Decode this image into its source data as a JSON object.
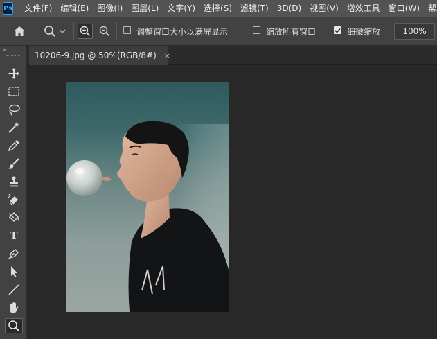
{
  "app": {
    "logo_text": "Ps"
  },
  "menu": {
    "items": [
      "文件(F)",
      "编辑(E)",
      "图像(I)",
      "图层(L)",
      "文字(Y)",
      "选择(S)",
      "滤镜(T)",
      "3D(D)",
      "视图(V)",
      "增效工具",
      "窗口(W)",
      "帮助(H)"
    ]
  },
  "options": {
    "resize_windows_label": "调整窗口大小以满屏显示",
    "resize_windows_checked": false,
    "zoom_all_windows_label": "缩放所有窗口",
    "zoom_all_windows_checked": false,
    "scrubby_zoom_label": "细微缩放",
    "scrubby_zoom_checked": true,
    "zoom_percent": "100%"
  },
  "document": {
    "tab_title": "10206-9.jpg @ 50%(RGB/8#)",
    "close_symbol": "×"
  },
  "toolbar": {
    "collapse_symbol": "»",
    "tools": [
      "move-tool",
      "marquee-tool",
      "lasso-tool",
      "magic-wand-tool",
      "eyedropper-tool",
      "brush-tool",
      "clone-stamp-tool",
      "eraser-tool",
      "paint-bucket-tool",
      "type-tool",
      "pen-tool",
      "path-selection-tool",
      "line-tool",
      "hand-tool",
      "zoom-tool"
    ],
    "type_tool_glyph": "T",
    "active_tool": "zoom-tool"
  },
  "colors": {
    "menubar": "#535353",
    "panel": "#424242",
    "canvas_bg": "#282828",
    "ps_blue": "#31a8ff"
  }
}
